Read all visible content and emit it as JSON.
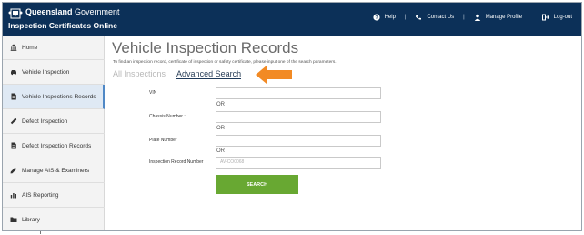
{
  "header": {
    "brand_bold": "Queensland",
    "brand_rest": "Government",
    "app_name": "Inspection Certificates Online",
    "nav": {
      "help": "Help",
      "separator": "|",
      "contact": "Contact Us",
      "profile": "Manage Profile",
      "logout": "Log-out"
    }
  },
  "sidebar": {
    "items": [
      {
        "label": "Home",
        "icon": "home-icon"
      },
      {
        "label": "Vehicle Inspection",
        "icon": "car-icon"
      },
      {
        "label": "Vehicle Inspections Records",
        "icon": "document-icon"
      },
      {
        "label": "Defect Inspection",
        "icon": "wrench-icon"
      },
      {
        "label": "Defect Inspection Records",
        "icon": "document-icon"
      },
      {
        "label": "Manage AIS & Examiners",
        "icon": "pencil-icon"
      },
      {
        "label": "AIS Reporting",
        "icon": "chart-icon"
      },
      {
        "label": "Library",
        "icon": "folder-icon"
      }
    ],
    "active_index": 2
  },
  "main": {
    "title": "Vehicle Inspection Records",
    "intro": "To find an inspection record, certificate of inspection or safety certificate, please input one of the search parameters.",
    "tabs": {
      "all": "All Inspections",
      "advanced": "Advanced Search"
    },
    "form": {
      "vin_label": "VIN",
      "chassis_label": "Chassis Number :",
      "plate_label": "Plate Number",
      "record_label": "Inspection Record Number",
      "record_placeholder": "AV-CO0068",
      "or": "OR",
      "search_button": "SEARCH"
    }
  },
  "colors": {
    "header_bg": "#0c3058",
    "accent_arrow": "#f28a24",
    "search_button": "#68a832",
    "active_sidebar": "#dfe9f4"
  }
}
